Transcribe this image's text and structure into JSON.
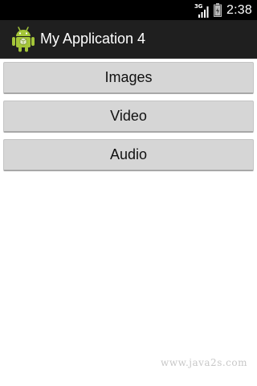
{
  "status_bar": {
    "network_type": "3G",
    "time": "2:38",
    "icons": [
      "signal-icon",
      "battery-icon"
    ]
  },
  "action_bar": {
    "icon": "android-robot-icon",
    "title": "My Application 4"
  },
  "buttons": [
    {
      "label": "Images"
    },
    {
      "label": "Video"
    },
    {
      "label": "Audio"
    }
  ],
  "watermark": "www.java2s.com",
  "colors": {
    "status_bar_bg": "#000000",
    "action_bar_bg": "#1f1f1f",
    "button_bg": "#d6d6d6",
    "android_green": "#a4c639"
  }
}
